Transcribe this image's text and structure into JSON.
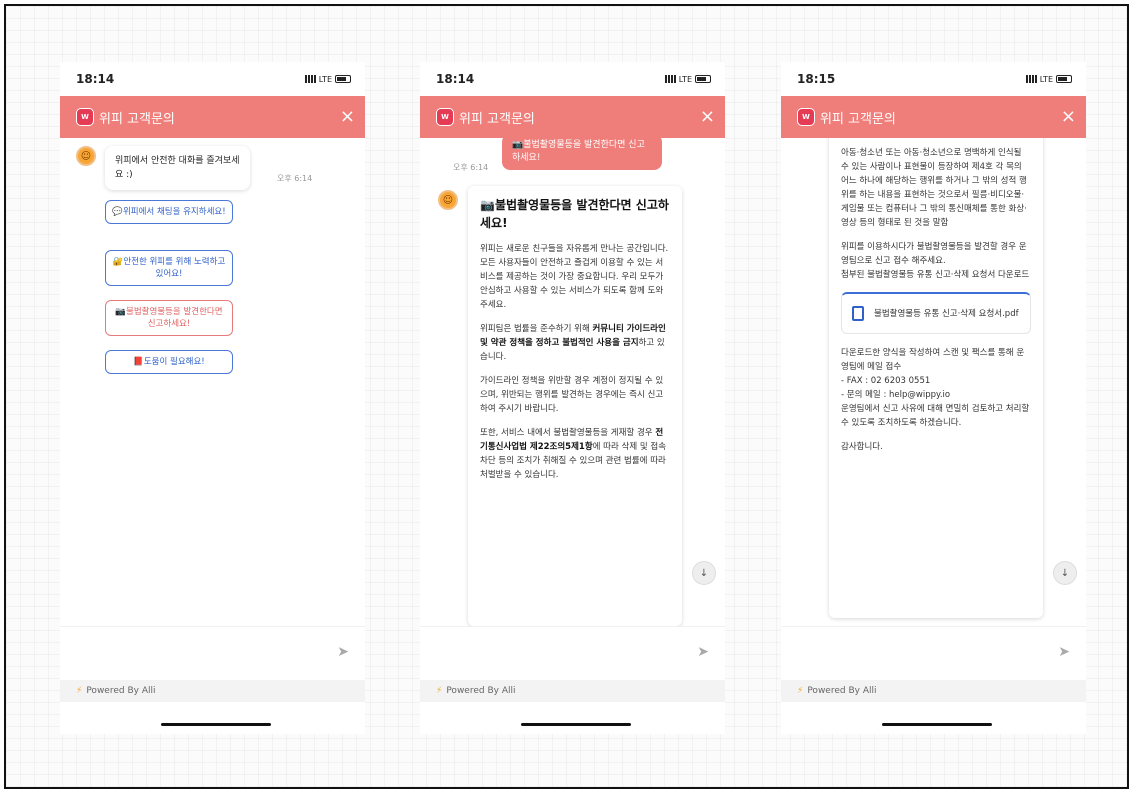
{
  "phones": [
    {
      "time": "18:14",
      "header": {
        "title": "위피 고객문의",
        "logo": "W"
      },
      "messages": {
        "bot_text": "위피에서 안전한 대화를 즐겨보세요 :)",
        "bot_time": "오후 6:14",
        "quick_replies": [
          "💬위피에서 채팅을 유지하세요!",
          "🔐안전한 위피를 위해 노력하고 있어요!",
          "📷불법촬영물등을 발견한다면 신고하세요!",
          "📕도움이 필요해요!"
        ]
      }
    },
    {
      "time": "18:14",
      "header": {
        "title": "위피 고객문의",
        "logo": "W"
      },
      "sent": "📷불법촬영물등을 발견한다면 신고하세요!",
      "sent_time": "오후 6:14",
      "card": {
        "title": "📷불법촬영물등을 발견한다면 신고하세요!",
        "p1": "위피는 새로운 친구들을 자유롭게 만나는 공간입니다. 모든 사용자들이 안전하고 즐겁게 이용할 수 있는 서비스를 제공하는 것이 가장 중요합니다. 우리 모두가 안심하고 사용할 수 있는 서비스가 되도록 함께 도와주세요.",
        "p2_a": "위피팀은 법률을 준수하기 위해 ",
        "p2_b": "커뮤니티 가이드라인 및 약관 정책을 정하고 불법적인 사용을 금지",
        "p2_c": "하고 있습니다.",
        "p3": "가이드라인 정책을 위반할 경우 계정이 정지될 수 있으며, 위반되는 행위를 발견하는 경우에는 즉시 신고하여 주시기 바랍니다.",
        "p4_a": "또한, 서비스 내에서 불법촬영물등을 게재할 경우 ",
        "p4_b": "전기통신사업법 제22조의5제1항",
        "p4_c": "에 따라 삭제 및 접속차단 등의 조치가 취해질 수 있으며 관련 법률에 따라 처벌받을 수 있습니다."
      }
    },
    {
      "time": "18:15",
      "header": {
        "title": "위피 고객문의",
        "logo": "W"
      },
      "card": {
        "p1": "아동·청소년 또는 아동·청소년으로 명백하게 인식될 수 있는 사람이나 표현물이 등장하여 제4호 각 목의 어느 하나에 해당하는 행위를 하거나 그 밖의 성적 행위를 하는 내용을 표현하는 것으로서 필름·비디오물·게임물 또는 컴퓨터나 그 밖의 통신매체를 통한 화상·영상 등의 형태로 된 것을 말함",
        "p2": "위피를 이용하시다가 불법촬영물등을 발견할 경우 운영팀으로 신고 접수 해주세요.",
        "p3": "첨부된 불법촬영물등 유통 신고·삭제 요청서 다운로드",
        "file_name": "불법촬영물등 유통 신고·삭제 요청서.pdf",
        "p4": "다운로드한 양식을 작성하여 스캔 및 팩스를 통해 운영팀에 메일 접수",
        "fax": "- FAX : 02 6203 0551",
        "mail": "- 문의 메일 : help@wippy.io",
        "p5": "운영팀에서 신고 사유에 대해 면밀히 검토하고 처리할 수 있도록 조치하도록 하겠습니다.",
        "thanks": "감사합니다."
      }
    }
  ],
  "powered_by": "Powered By Alli",
  "icons": {
    "close": "×",
    "send": "➤",
    "scroll": "↓"
  }
}
